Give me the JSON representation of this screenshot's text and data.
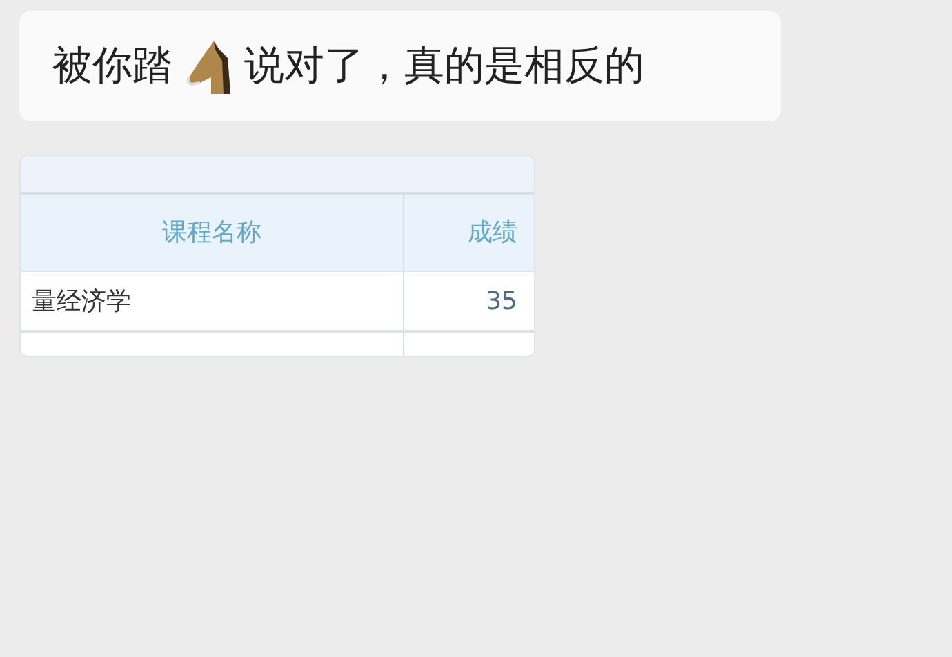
{
  "message": {
    "text_before": "被你踏",
    "text_after": "说对了，真的是相反的"
  },
  "table_image": {
    "columns": [
      "课程名称",
      "成绩"
    ],
    "rows": [
      [
        "量经济学",
        "35"
      ]
    ]
  }
}
